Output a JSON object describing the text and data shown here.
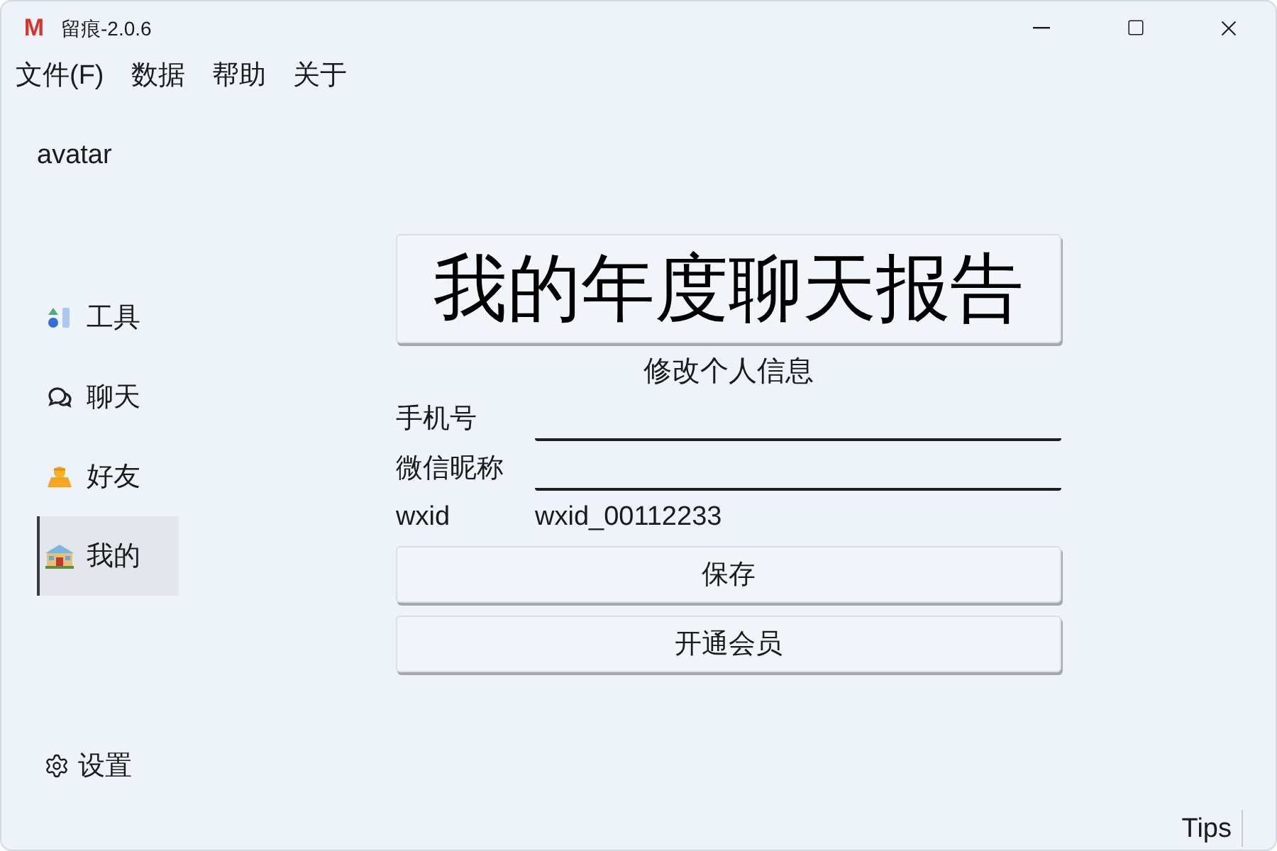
{
  "window": {
    "logo": "M",
    "title": "留痕-2.0.6"
  },
  "menu": [
    "文件(F)",
    "数据",
    "帮助",
    "关于"
  ],
  "sidebar": {
    "avatar": "avatar",
    "items": [
      {
        "label": "工具",
        "selected": false
      },
      {
        "label": "聊天",
        "selected": false
      },
      {
        "label": "好友",
        "selected": false
      },
      {
        "label": "我的",
        "selected": true
      }
    ],
    "settings": "设置"
  },
  "main": {
    "report_button": "我的年度聊天报告",
    "section_title": "修改个人信息",
    "fields": [
      {
        "label": "手机号"
      },
      {
        "label": "微信昵称"
      }
    ],
    "wxid": {
      "label": "wxid",
      "value": "wxid_00112233"
    },
    "buttons": [
      "保存",
      "开通会员"
    ]
  },
  "status_bar": {
    "tips": "Tips"
  }
}
